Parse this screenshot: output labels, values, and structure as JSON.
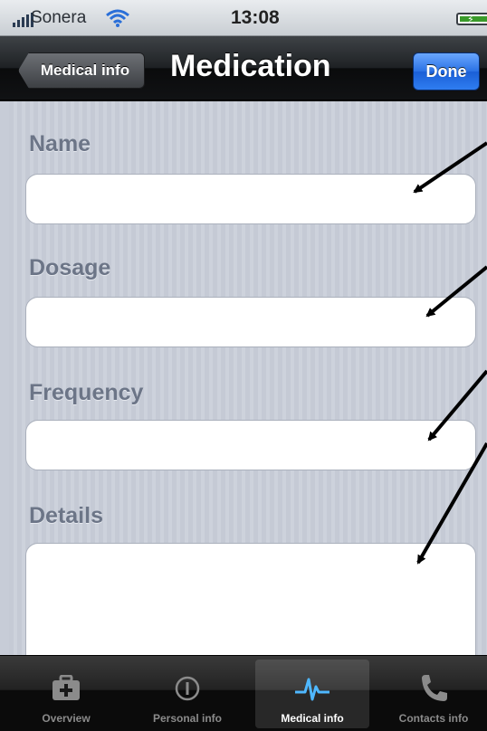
{
  "status_bar": {
    "carrier": "Sonera",
    "time": "13:08"
  },
  "nav": {
    "back_label": "Medical info",
    "title": "Medication",
    "done_label": "Done"
  },
  "form": {
    "name_label": "Name",
    "dosage_label": "Dosage",
    "frequency_label": "Frequency",
    "details_label": "Details",
    "name_value": "",
    "dosage_value": "",
    "frequency_value": "",
    "details_value": ""
  },
  "tabs": [
    {
      "label": "Overview",
      "icon": "first-aid-kit-icon"
    },
    {
      "label": "Personal info",
      "icon": "info-icon"
    },
    {
      "label": "Medical info",
      "icon": "heartbeat-icon",
      "active": true
    },
    {
      "label": "Contacts info",
      "icon": "phone-icon"
    }
  ],
  "colors": {
    "accent": "#2a71e4",
    "active_tab_icon": "#4fb8ff"
  }
}
